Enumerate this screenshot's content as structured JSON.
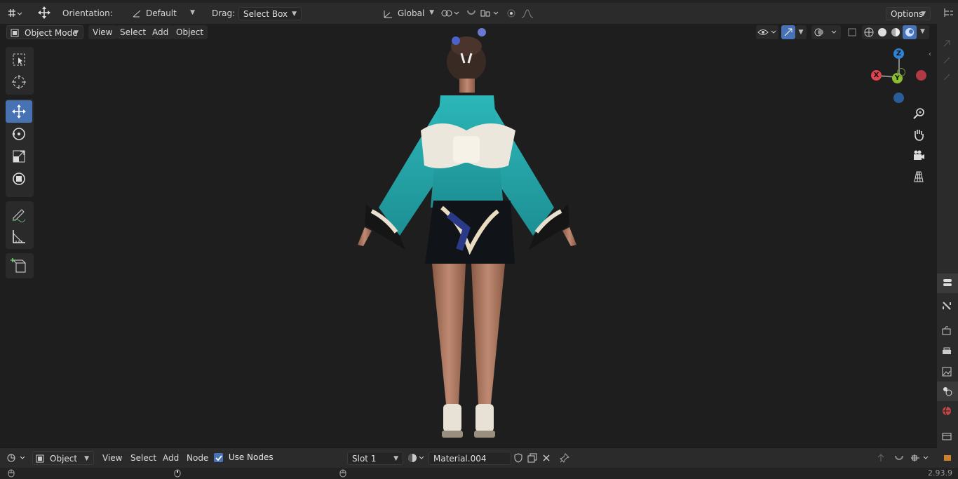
{
  "header": {
    "orientation_label": "Orientation:",
    "orientation_value": "Default",
    "drag_label": "Drag:",
    "drag_value": "Select Box",
    "transform_space": "Global",
    "options_label": "Options"
  },
  "viewport_header": {
    "mode": "Object Mode",
    "menus": [
      "View",
      "Select",
      "Add",
      "Object"
    ]
  },
  "toolbar": {
    "tools": [
      {
        "name": "select-box",
        "icon": "select-box-icon",
        "active": false
      },
      {
        "name": "cursor",
        "icon": "cursor-icon",
        "active": false
      },
      {
        "name": "move",
        "icon": "move-icon",
        "active": true
      },
      {
        "name": "rotate",
        "icon": "rotate-icon",
        "active": false
      },
      {
        "name": "scale",
        "icon": "scale-icon",
        "active": false
      },
      {
        "name": "transform",
        "icon": "transform-icon",
        "active": false
      },
      {
        "name": "annotate",
        "icon": "annotate-icon",
        "active": false
      },
      {
        "name": "measure",
        "icon": "measure-icon",
        "active": false
      },
      {
        "name": "add-cube",
        "icon": "add-cube-icon",
        "active": false
      }
    ]
  },
  "gizmo": {
    "z": "Z",
    "y": "Y",
    "x": "X",
    "colors": {
      "x": "#e04350",
      "y": "#8ac030",
      "z": "#2f83d6"
    }
  },
  "node_editor_header": {
    "object_type": "Object",
    "menus": [
      "View",
      "Select",
      "Add",
      "Node"
    ],
    "use_nodes_label": "Use Nodes",
    "use_nodes_checked": true,
    "slot": "Slot 1",
    "material": "Material.004"
  },
  "status": {
    "version": "2.93.9"
  },
  "colors": {
    "accent": "#4772b3",
    "background": "#1e1e1e",
    "panel": "#2b2b2b"
  }
}
